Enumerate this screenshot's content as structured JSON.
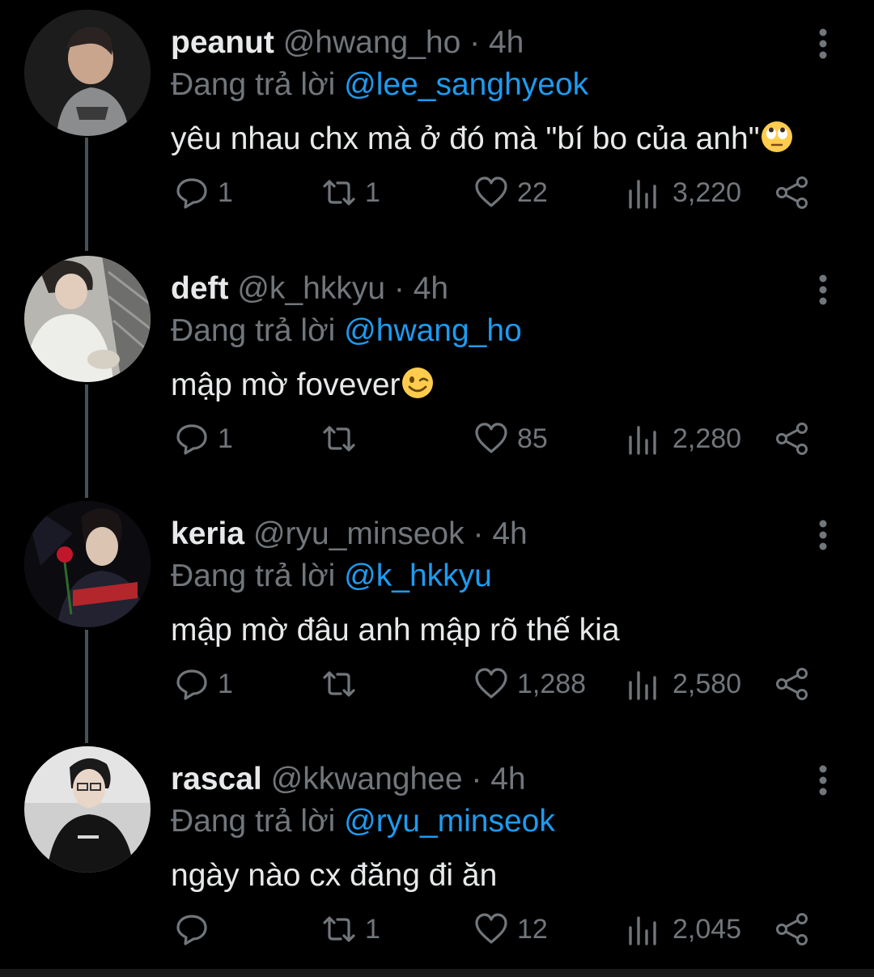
{
  "reply_prefix": "Đang trả lời",
  "colors": {
    "background": "#000000",
    "text": "#e7e9ea",
    "muted": "#71767b",
    "accent": "#1d9bf0",
    "thread_line": "#4a4f54"
  },
  "tweets": [
    {
      "name": "peanut",
      "handle": "@hwang_ho",
      "separator": "·",
      "time": "4h",
      "reply_to": "@lee_sanghyeok",
      "text": "yêu nhau chx mà ở đó mà \"bí bo của anh\"",
      "emoji": "face-with-rolling-eyes-emoji",
      "replies": "1",
      "retweets": "1",
      "likes": "22",
      "views": "3,220"
    },
    {
      "name": "deft",
      "handle": "@k_hkkyu",
      "separator": "·",
      "time": "4h",
      "reply_to": "@hwang_ho",
      "text": "mập mờ fovever",
      "emoji": "winking-face-emoji",
      "replies": "1",
      "retweets": "",
      "likes": "85",
      "views": "2,280"
    },
    {
      "name": "keria",
      "handle": "@ryu_minseok",
      "separator": "·",
      "time": "4h",
      "reply_to": "@k_hkkyu",
      "text": "mập mờ đâu anh mập rõ thế kia",
      "emoji": "",
      "replies": "1",
      "retweets": "",
      "likes": "1,288",
      "views": "2,580"
    },
    {
      "name": "rascal",
      "handle": "@kkwanghee",
      "separator": "·",
      "time": "4h",
      "reply_to": "@ryu_minseok",
      "text": "ngày nào cx đăng đi ăn",
      "emoji": "",
      "replies": "",
      "retweets": "1",
      "likes": "12",
      "views": "2,045"
    }
  ],
  "icons": {
    "reply": "reply-icon",
    "retweet": "retweet-icon",
    "like": "heart-icon",
    "views": "views-icon",
    "share": "share-icon",
    "more": "more-vertical-icon"
  }
}
